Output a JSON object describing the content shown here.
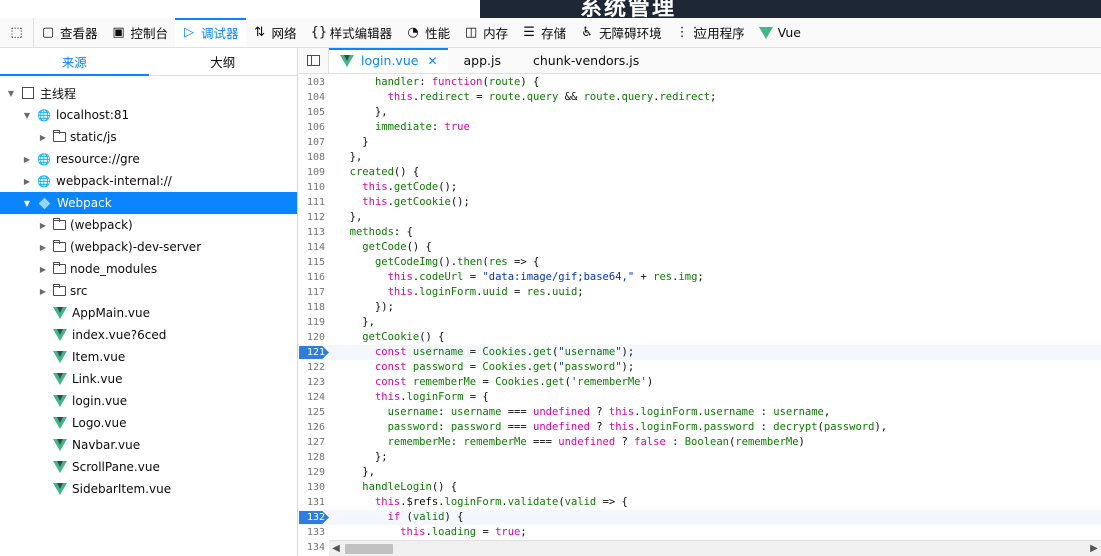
{
  "banner": {
    "text": "系统管理"
  },
  "toolbar": {
    "tools": [
      {
        "label": "查看器",
        "icon": "inspector-icon"
      },
      {
        "label": "控制台",
        "icon": "console-icon"
      },
      {
        "label": "调试器",
        "icon": "debugger-icon",
        "active": true
      },
      {
        "label": "网络",
        "icon": "network-icon"
      },
      {
        "label": "样式编辑器",
        "icon": "style-editor-icon"
      },
      {
        "label": "性能",
        "icon": "performance-icon"
      },
      {
        "label": "内存",
        "icon": "memory-icon"
      },
      {
        "label": "存储",
        "icon": "storage-icon"
      },
      {
        "label": "无障碍环境",
        "icon": "accessibility-icon"
      },
      {
        "label": "应用程序",
        "icon": "application-icon"
      },
      {
        "label": "Vue",
        "icon": "vue-icon"
      }
    ]
  },
  "left": {
    "tabs": [
      "来源",
      "大纲"
    ],
    "tree": [
      {
        "label": "主线程",
        "depth": 0,
        "twisty": "▼",
        "kind": "page"
      },
      {
        "label": "localhost:81",
        "depth": 1,
        "twisty": "▼",
        "kind": "globe"
      },
      {
        "label": "static/js",
        "depth": 2,
        "twisty": "▶",
        "kind": "folder"
      },
      {
        "label": "resource://gre",
        "depth": 1,
        "twisty": "▶",
        "kind": "globe"
      },
      {
        "label": "webpack-internal://",
        "depth": 1,
        "twisty": "▶",
        "kind": "globe"
      },
      {
        "label": "Webpack",
        "depth": 1,
        "twisty": "▼",
        "kind": "webpack",
        "selected": true
      },
      {
        "label": "(webpack)",
        "depth": 2,
        "twisty": "▶",
        "kind": "folder"
      },
      {
        "label": "(webpack)-dev-server",
        "depth": 2,
        "twisty": "▶",
        "kind": "folder"
      },
      {
        "label": "node_modules",
        "depth": 2,
        "twisty": "▶",
        "kind": "folder"
      },
      {
        "label": "src",
        "depth": 2,
        "twisty": "▶",
        "kind": "folder"
      },
      {
        "label": "AppMain.vue",
        "depth": 2,
        "twisty": "",
        "kind": "vue"
      },
      {
        "label": "index.vue?6ced",
        "depth": 2,
        "twisty": "",
        "kind": "vue"
      },
      {
        "label": "Item.vue",
        "depth": 2,
        "twisty": "",
        "kind": "vue"
      },
      {
        "label": "Link.vue",
        "depth": 2,
        "twisty": "",
        "kind": "vue"
      },
      {
        "label": "login.vue",
        "depth": 2,
        "twisty": "",
        "kind": "vue"
      },
      {
        "label": "Logo.vue",
        "depth": 2,
        "twisty": "",
        "kind": "vue"
      },
      {
        "label": "Navbar.vue",
        "depth": 2,
        "twisty": "",
        "kind": "vue"
      },
      {
        "label": "ScrollPane.vue",
        "depth": 2,
        "twisty": "",
        "kind": "vue"
      },
      {
        "label": "SidebarItem.vue",
        "depth": 2,
        "twisty": "",
        "kind": "vue"
      }
    ]
  },
  "editor": {
    "tabs": [
      {
        "label": "login.vue",
        "active": true,
        "closable": true
      },
      {
        "label": "app.js"
      },
      {
        "label": "chunk-vendors.js"
      }
    ],
    "breakpoints": [
      121,
      132
    ],
    "last_line_number": "134",
    "lines": [
      {
        "n": "103",
        "t": "      handler: function(route) {"
      },
      {
        "n": "104",
        "t": "        this.redirect = route.query && route.query.redirect;"
      },
      {
        "n": "105",
        "t": "      },"
      },
      {
        "n": "106",
        "t": "      immediate: true"
      },
      {
        "n": "107",
        "t": "    }"
      },
      {
        "n": "108",
        "t": "  },"
      },
      {
        "n": "109",
        "t": "  created() {"
      },
      {
        "n": "110",
        "t": "    this.getCode();"
      },
      {
        "n": "111",
        "t": "    this.getCookie();"
      },
      {
        "n": "112",
        "t": "  },"
      },
      {
        "n": "113",
        "t": "  methods: {"
      },
      {
        "n": "114",
        "t": "    getCode() {"
      },
      {
        "n": "115",
        "t": "      getCodeImg().then(res => {"
      },
      {
        "n": "116",
        "t": "        this.codeUrl = \"data:image/gif;base64,\" + res.img;"
      },
      {
        "n": "117",
        "t": "        this.loginForm.uuid = res.uuid;"
      },
      {
        "n": "118",
        "t": "      });"
      },
      {
        "n": "119",
        "t": "    },"
      },
      {
        "n": "120",
        "t": "    getCookie() {"
      },
      {
        "n": "121",
        "t": "      const username = Cookies.get(\"username\");"
      },
      {
        "n": "122",
        "t": "      const password = Cookies.get(\"password\");"
      },
      {
        "n": "123",
        "t": "      const rememberMe = Cookies.get('rememberMe')"
      },
      {
        "n": "124",
        "t": "      this.loginForm = {"
      },
      {
        "n": "125",
        "t": "        username: username === undefined ? this.loginForm.username : username,"
      },
      {
        "n": "126",
        "t": "        password: password === undefined ? this.loginForm.password : decrypt(password),"
      },
      {
        "n": "127",
        "t": "        rememberMe: rememberMe === undefined ? false : Boolean(rememberMe)"
      },
      {
        "n": "128",
        "t": "      };"
      },
      {
        "n": "129",
        "t": "    },"
      },
      {
        "n": "130",
        "t": "    handleLogin() {"
      },
      {
        "n": "131",
        "t": "      this.$refs.loginForm.validate(valid => {"
      },
      {
        "n": "132",
        "t": "        if (valid) {"
      },
      {
        "n": "133",
        "t": "          this.loading = true;"
      }
    ]
  }
}
